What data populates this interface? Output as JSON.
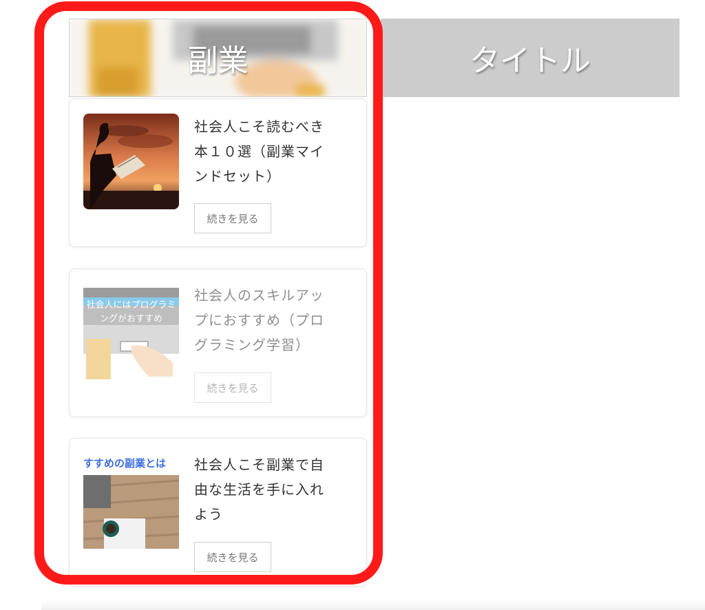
{
  "tabs": [
    {
      "label": "副業",
      "active": true
    },
    {
      "label": "タイトル",
      "active": false
    }
  ],
  "articles": [
    {
      "title": "社会人こそ読むべき本１０選（副業マインドセット）",
      "title_lines": [
        "社会人こそ読むべき",
        "本１０選（副業マイ",
        "ンドセット）"
      ],
      "button": "続きを見る",
      "thumb_icon": "reading-silhouette-sunset-image"
    },
    {
      "title": "社会人のスキルアップにおすすめ（プログラミング学習）",
      "title_lines": [
        "社会人のスキルアッ",
        "プにおすすめ（プロ",
        "グラミング学習）"
      ],
      "button": "続きを見る",
      "thumb_icon": "laptop-typing-image",
      "thumb_caption": [
        "社会人にはプログラミ",
        "ングがおすすめ"
      ],
      "dimmed": true
    },
    {
      "title": "社会人こそ副業で自由な生活を手に入れよう",
      "title_lines": [
        "社会人こそ副業で自",
        "由な生活を手に入れ",
        "よう"
      ],
      "button": "続きを見る",
      "thumb_icon": "desk-coffee-laptop-image",
      "thumb_caption": [
        "すすめの副業とは"
      ]
    }
  ],
  "colors": {
    "highlight": "#ff1a1a",
    "inactive_tab": "#cccccc",
    "caption_blue": "#3d6fe0"
  }
}
